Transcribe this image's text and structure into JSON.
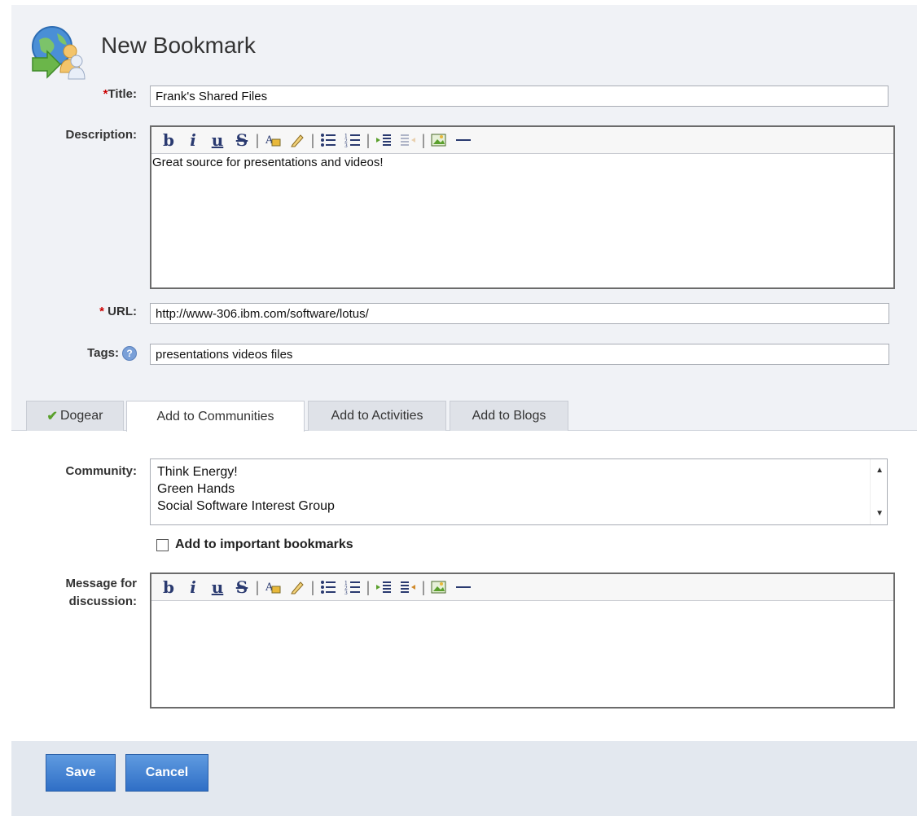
{
  "page": {
    "title": "New Bookmark"
  },
  "icons": {
    "app": "bookmark-globe-people-icon",
    "help": "help-icon",
    "check": "check-icon"
  },
  "fields": {
    "title": {
      "label": "Title:",
      "required_mark": "*",
      "value": "Frank's Shared Files"
    },
    "description": {
      "label": "Description:",
      "value": "Great source for presentations and videos!"
    },
    "url": {
      "label": "URL:",
      "required_mark": "* ",
      "value": "http://www-306.ibm.com/software/lotus/"
    },
    "tags": {
      "label": "Tags:",
      "help_glyph": "?",
      "value": "presentations videos files"
    }
  },
  "toolbar": {
    "bold": "b",
    "italic": "i",
    "underline": "u",
    "strike": "S",
    "separator": "|",
    "font_color_icon": "font-color-icon",
    "highlight_icon": "highlight-pen-icon",
    "bullet_list_icon": "bullet-list-icon",
    "numbered_list_icon": "numbered-list-icon",
    "indent_icon": "indent-icon",
    "outdent_icon": "outdent-icon",
    "image_icon": "insert-image-icon",
    "hr_icon": "horizontal-rule-icon"
  },
  "tabs": [
    {
      "label": "Dogear"
    },
    {
      "label": "Add to Communities"
    },
    {
      "label": "Add to Activities"
    },
    {
      "label": "Add to Blogs"
    }
  ],
  "community": {
    "label": "Community:",
    "options": [
      "Think Energy!",
      "Green Hands",
      "Social Software Interest Group"
    ]
  },
  "important": {
    "label": "Add to important bookmarks",
    "checked": false
  },
  "message": {
    "label_line1": "Message for",
    "label_line2": "discussion:",
    "value": ""
  },
  "buttons": {
    "save": "Save",
    "cancel": "Cancel"
  },
  "colors": {
    "accent": "#3a7bd5",
    "required": "#cc0000",
    "panel": "#f0f2f6",
    "footer": "#e3e8ef"
  }
}
